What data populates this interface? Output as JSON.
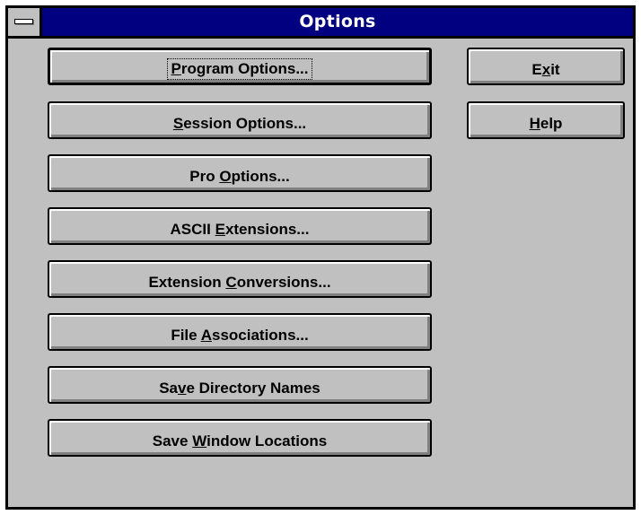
{
  "window": {
    "title": "Options"
  },
  "system_menu_icon": "minus-icon",
  "colors": {
    "titlebar": "#000080",
    "face": "#c0c0c0",
    "title_text": "#ffffff"
  },
  "buttons_left": [
    {
      "pre": "",
      "key": "P",
      "post": "rogram Options..."
    },
    {
      "pre": "",
      "key": "S",
      "post": "ession Options..."
    },
    {
      "pre": "Pro ",
      "key": "O",
      "post": "ptions..."
    },
    {
      "pre": "ASCII ",
      "key": "E",
      "post": "xtensions..."
    },
    {
      "pre": "Extension ",
      "key": "C",
      "post": "onversions..."
    },
    {
      "pre": "File ",
      "key": "A",
      "post": "ssociations..."
    },
    {
      "pre": "Sa",
      "key": "v",
      "post": "e Directory Names"
    },
    {
      "pre": "Save ",
      "key": "W",
      "post": "indow Locations"
    }
  ],
  "buttons_right": [
    {
      "pre": "E",
      "key": "x",
      "post": "it"
    },
    {
      "pre": "",
      "key": "H",
      "post": "elp"
    }
  ]
}
